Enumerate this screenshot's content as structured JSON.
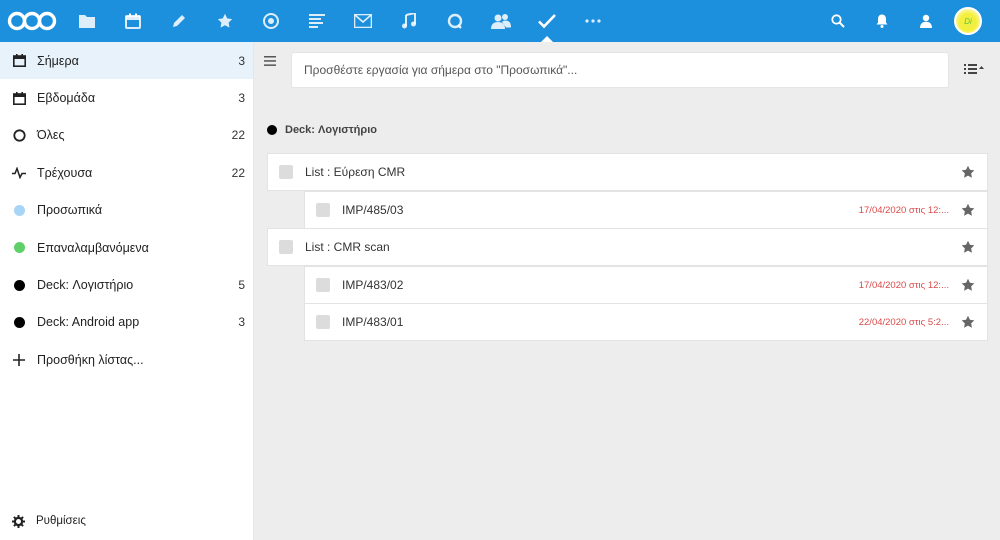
{
  "header": {
    "apps": [
      {
        "name": "files-icon"
      },
      {
        "name": "calendar-icon"
      },
      {
        "name": "pencil-icon"
      },
      {
        "name": "star-icon"
      },
      {
        "name": "activity-icon"
      },
      {
        "name": "notes-icon"
      },
      {
        "name": "mail-icon"
      },
      {
        "name": "music-icon"
      },
      {
        "name": "talk-icon"
      },
      {
        "name": "contacts-icon"
      },
      {
        "name": "tasks-icon",
        "active": true
      },
      {
        "name": "more-icon"
      }
    ],
    "avatar_text": "Di"
  },
  "sidebar": {
    "items": [
      {
        "label": "Σήμερα",
        "count": "3",
        "icon": "calendar-today-icon",
        "active": true
      },
      {
        "label": "Εβδομάδα",
        "count": "3",
        "icon": "calendar-week-icon"
      },
      {
        "label": "Όλες",
        "count": "22",
        "icon": "circle-outline-icon"
      },
      {
        "label": "Τρέχουσα",
        "count": "22",
        "icon": "pulse-icon"
      },
      {
        "label": "Προσωπικά",
        "count": "",
        "icon": "dot-icon",
        "color": "#a8d4f5"
      },
      {
        "label": "Επαναλαμβανόμενα",
        "count": "",
        "icon": "dot-icon",
        "color": "#5fd068"
      },
      {
        "label": "Deck: Λογιστήριο",
        "count": "5",
        "icon": "dot-icon",
        "color": "#000000"
      },
      {
        "label": "Deck: Android app",
        "count": "3",
        "icon": "dot-icon",
        "color": "#000000"
      },
      {
        "label": "Προσθήκη λίστας...",
        "count": "",
        "icon": "plus-icon"
      }
    ],
    "settings_label": "Ρυθμίσεις"
  },
  "main": {
    "add_placeholder": "Προσθέστε εργασία για σήμερα στο \"Προσωπικά\"...",
    "list_title": "Deck: Λογιστήριο",
    "list_color": "#000000",
    "tasks": [
      {
        "label": "List : Εύρεση CMR",
        "due": "",
        "level": 0
      },
      {
        "label": "IMP/485/03",
        "due": "17/04/2020 στις 12:...",
        "level": 1
      },
      {
        "label": "List : CMR scan",
        "due": "",
        "level": 0
      },
      {
        "label": "IMP/483/02",
        "due": "17/04/2020 στις 12:...",
        "level": 1
      },
      {
        "label": "IMP/483/01",
        "due": "22/04/2020 στις 5:2...",
        "level": 1
      }
    ]
  },
  "colors": {
    "header": "#1c8fdd",
    "due": "#d94a4a"
  }
}
